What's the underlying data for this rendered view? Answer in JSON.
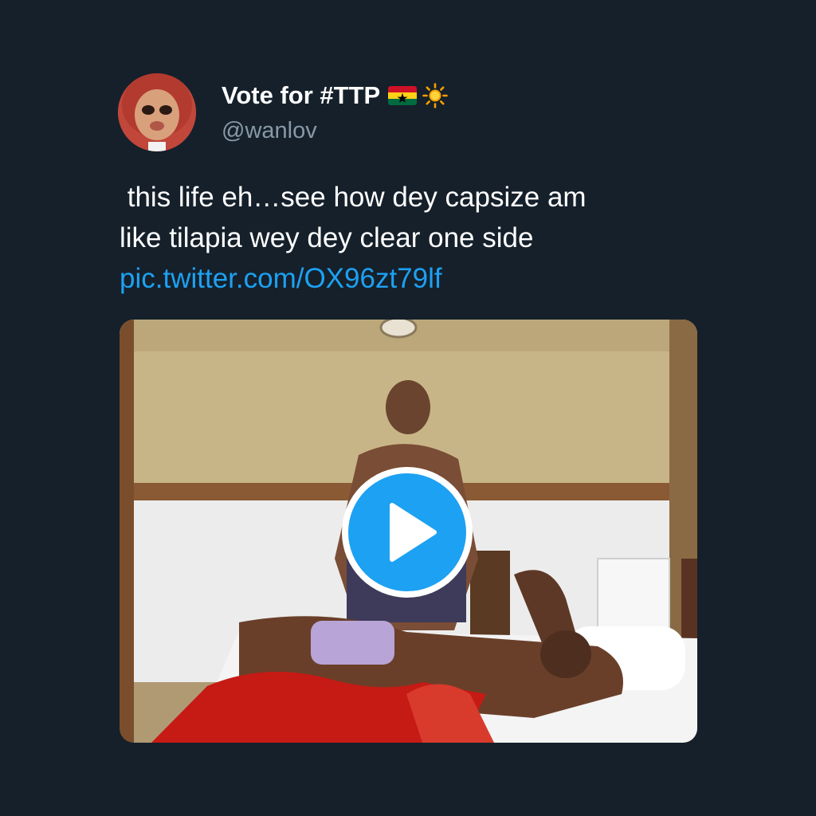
{
  "tweet": {
    "author": {
      "display_name": "Vote for #TTP",
      "handle": "@wanlov",
      "badges": [
        "ghana-flag-icon",
        "sun-icon"
      ]
    },
    "text_lines": [
      " this life eh…see how dey capsize am",
      "like tilapia wey dey clear one side"
    ],
    "link_text": "pic.twitter.com/OX96zt79lf",
    "media": {
      "type": "video",
      "play_icon": "play-icon"
    }
  },
  "colors": {
    "background": "#15202b",
    "text": "#ffffff",
    "secondary_text": "#8899a6",
    "link": "#1da1f2",
    "play_button": "#1da1f2"
  }
}
